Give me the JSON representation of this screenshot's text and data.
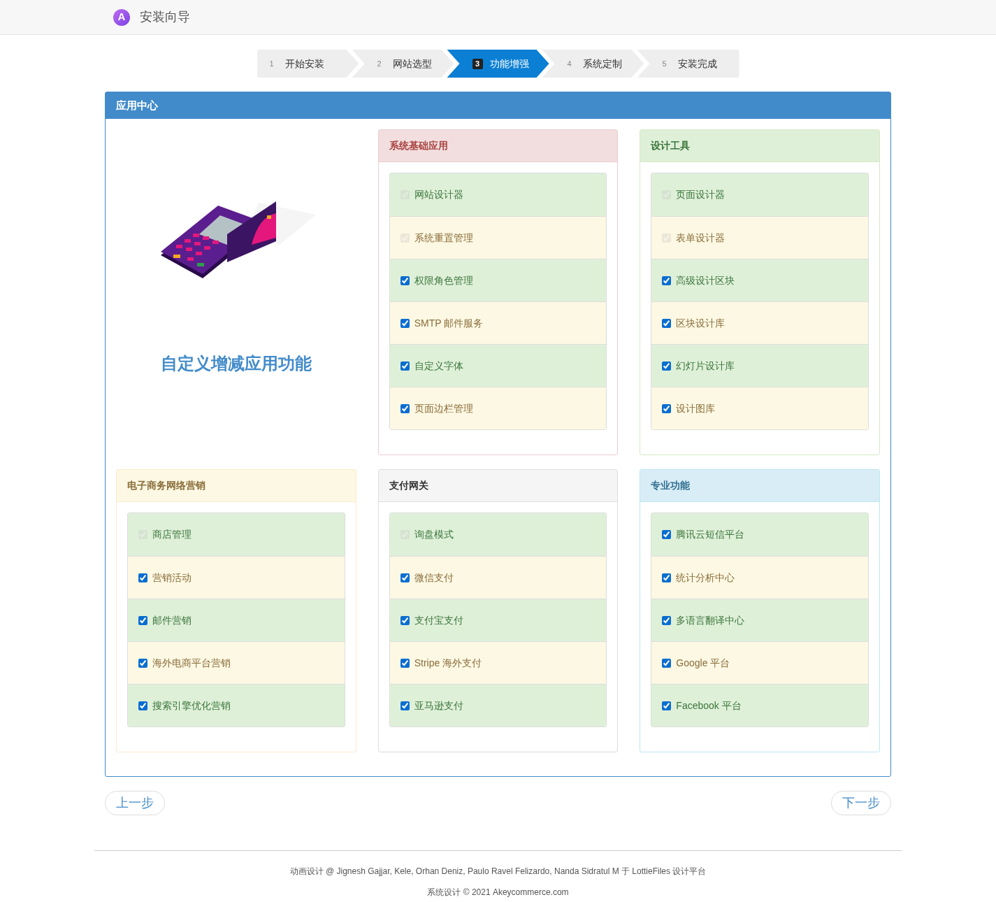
{
  "header": {
    "logo_letter": "A",
    "title": "安装向导"
  },
  "steps": [
    {
      "number": "1",
      "label": "开始安装",
      "selected": false
    },
    {
      "number": "2",
      "label": "网站选型",
      "selected": false
    },
    {
      "number": "3",
      "label": "功能增强",
      "selected": true
    },
    {
      "number": "4",
      "label": "系统定制",
      "selected": false
    },
    {
      "number": "5",
      "label": "安装完成",
      "selected": false
    }
  ],
  "main_panel": {
    "title": "应用中心",
    "tagline": "自定义增减应用功能"
  },
  "groups": [
    {
      "title": "系统基础应用",
      "kind": "danger",
      "items": [
        {
          "label": "网站设计器",
          "checked": true,
          "disabled": true
        },
        {
          "label": "系统重置管理",
          "checked": true,
          "disabled": true
        },
        {
          "label": "权限角色管理",
          "checked": true,
          "disabled": false
        },
        {
          "label": "SMTP 邮件服务",
          "checked": true,
          "disabled": false
        },
        {
          "label": "自定义字体",
          "checked": true,
          "disabled": false
        },
        {
          "label": "页面边栏管理",
          "checked": true,
          "disabled": false
        }
      ]
    },
    {
      "title": "设计工具",
      "kind": "success",
      "items": [
        {
          "label": "页面设计器",
          "checked": true,
          "disabled": true
        },
        {
          "label": "表单设计器",
          "checked": true,
          "disabled": true
        },
        {
          "label": "高级设计区块",
          "checked": true,
          "disabled": false
        },
        {
          "label": "区块设计库",
          "checked": true,
          "disabled": false
        },
        {
          "label": "幻灯片设计库",
          "checked": true,
          "disabled": false
        },
        {
          "label": "设计图库",
          "checked": true,
          "disabled": false
        }
      ]
    },
    {
      "title": "电子商务网络营销",
      "kind": "warning",
      "items": [
        {
          "label": "商店管理",
          "checked": true,
          "disabled": true
        },
        {
          "label": "营销活动",
          "checked": true,
          "disabled": false
        },
        {
          "label": "邮件营销",
          "checked": true,
          "disabled": false
        },
        {
          "label": "海外电商平台营销",
          "checked": true,
          "disabled": false
        },
        {
          "label": "搜索引擎优化营销",
          "checked": true,
          "disabled": false
        }
      ]
    },
    {
      "title": "支付网关",
      "kind": "default",
      "items": [
        {
          "label": "询盘模式",
          "checked": true,
          "disabled": true
        },
        {
          "label": "微信支付",
          "checked": true,
          "disabled": false
        },
        {
          "label": "支付宝支付",
          "checked": true,
          "disabled": false
        },
        {
          "label": "Stripe 海外支付",
          "checked": true,
          "disabled": false
        },
        {
          "label": "亚马逊支付",
          "checked": true,
          "disabled": false
        }
      ]
    },
    {
      "title": "专业功能",
      "kind": "info",
      "items": [
        {
          "label": "腾讯云短信平台",
          "checked": true,
          "disabled": false
        },
        {
          "label": "统计分析中心",
          "checked": true,
          "disabled": false
        },
        {
          "label": "多语言翻译中心",
          "checked": true,
          "disabled": false
        },
        {
          "label": "Google 平台",
          "checked": true,
          "disabled": false
        },
        {
          "label": "Facebook 平台",
          "checked": true,
          "disabled": false
        }
      ]
    }
  ],
  "buttons": {
    "previous": "上一步",
    "next": "下一步"
  },
  "footer": {
    "credits": "动画设计 @ Jignesh Gajjar, Kele, Orhan Deniz, Paulo Ravel Felizardo, Nanda Sidratul M 于 LottieFiles 设计平台",
    "copyright": "系统设计 © 2021 Akeycommerce.com"
  }
}
